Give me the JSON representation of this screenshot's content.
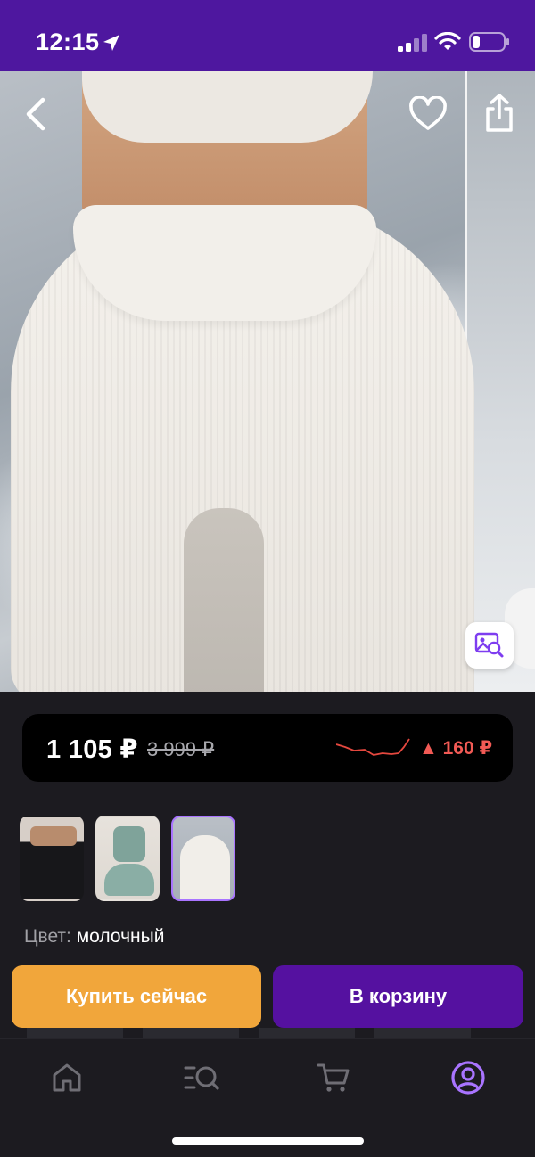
{
  "status_bar": {
    "time": "12:15",
    "icons": [
      "location-arrow-icon",
      "signal-icon",
      "wifi-icon",
      "battery-icon"
    ]
  },
  "hero": {
    "icons": [
      "back-icon",
      "heart-icon",
      "share-icon",
      "image-search-icon"
    ]
  },
  "price": {
    "current": "1 105 ₽",
    "old": "3 999 ₽",
    "change": "▲ 160 ₽",
    "change_color": "#f25a55"
  },
  "variants": {
    "selected_index": 2,
    "items": [
      "black",
      "sage",
      "milky"
    ]
  },
  "color": {
    "label": "Цвет:",
    "value": "молочный"
  },
  "actions": {
    "buy_now": "Купить сейчас",
    "add_to_cart": "В корзину"
  },
  "bottom_nav": {
    "items": [
      "home-icon",
      "catalog-search-icon",
      "cart-icon",
      "profile-icon"
    ],
    "active": "profile-icon",
    "active_color": "#a974ff",
    "inactive_color": "#6f6e75"
  },
  "colors": {
    "brand": "#4e179f",
    "buy_button": "#f1a63b",
    "cart_button": "#5511a0"
  }
}
